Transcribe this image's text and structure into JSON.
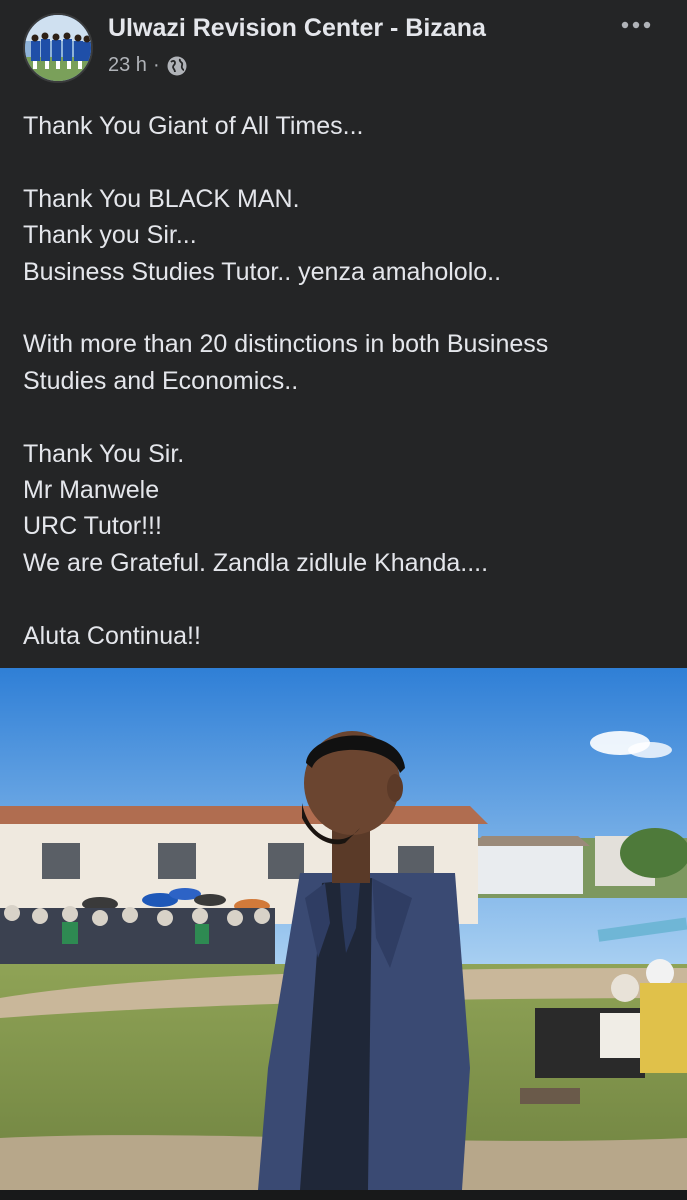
{
  "post": {
    "page_name": "Ulwazi Revision Center - Bizana",
    "time": "23 h",
    "separator": "·",
    "audience_icon": "globe-icon",
    "more_icon": "more-options-icon",
    "lines": [
      "Thank You Giant of All Times...",
      "",
      "Thank You BLACK MAN.",
      "Thank you Sir...",
      "Business Studies Tutor.. yenza amahololo..",
      "",
      "With more than 20 distinctions in both Business",
      "Studies and Economics..",
      "",
      "Thank You Sir.",
      "Mr Manwele",
      "URC Tutor!!!",
      "We are Grateful.  Zandla zidlule Khanda....",
      "",
      "Aluta Continua!!"
    ]
  },
  "colors": {
    "background": "#242526",
    "text": "#e4e6eb",
    "secondary_text": "#b0b3b8"
  }
}
